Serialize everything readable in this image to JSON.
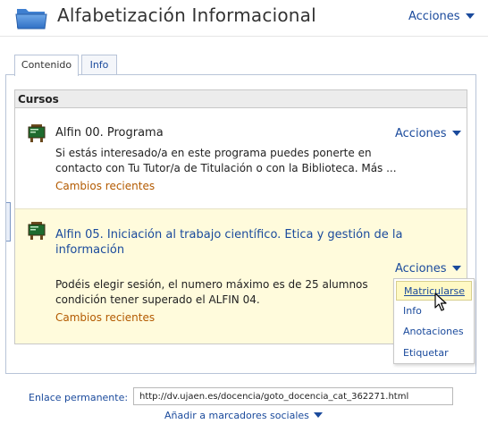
{
  "header": {
    "title": "Alfabetización Informacional",
    "actions_label": "Acciones",
    "icon": "folder-icon"
  },
  "tabs": [
    {
      "label": "Contenido",
      "active": true
    },
    {
      "label": "Info",
      "active": false
    }
  ],
  "cursos": {
    "heading": "Cursos",
    "items": [
      {
        "title": "Alfin 00. Programa",
        "description_lines": [
          "Si estás interesado/a en este programa puedes ponerte en",
          "contacto con Tu Tutor/a de Titulación o con la Biblioteca. Más ..."
        ],
        "recent_changes": "Cambios recientes",
        "actions_label": "Acciones",
        "icon": "course-board-icon"
      },
      {
        "title_lines": [
          "Alfin 05. Iniciación al trabajo científico. Etica y gestión de la",
          "información"
        ],
        "description_lines": [
          "Podéis elegir sesión, el numero máximo es de 25 alumnos",
          "condición tener superado el ALFIN 04."
        ],
        "recent_changes": "Cambios recientes",
        "actions_label": "Acciones",
        "icon": "course-board-icon"
      }
    ]
  },
  "actions_menu": {
    "items": [
      "Matricularse",
      "Info",
      "Anotaciones",
      "Etiquetar"
    ],
    "hovered": "Matricularse"
  },
  "footer": {
    "permalink_label": "Enlace permanente:",
    "permalink_value": "http://dv.ujaen.es/docencia/goto_docencia_cat_362271.html",
    "social_label": "Añadir a marcadores sociales"
  },
  "colors": {
    "link": "#1a4a9c",
    "highlight_row": "#fffbdc",
    "recent_changes": "#b35a00"
  }
}
